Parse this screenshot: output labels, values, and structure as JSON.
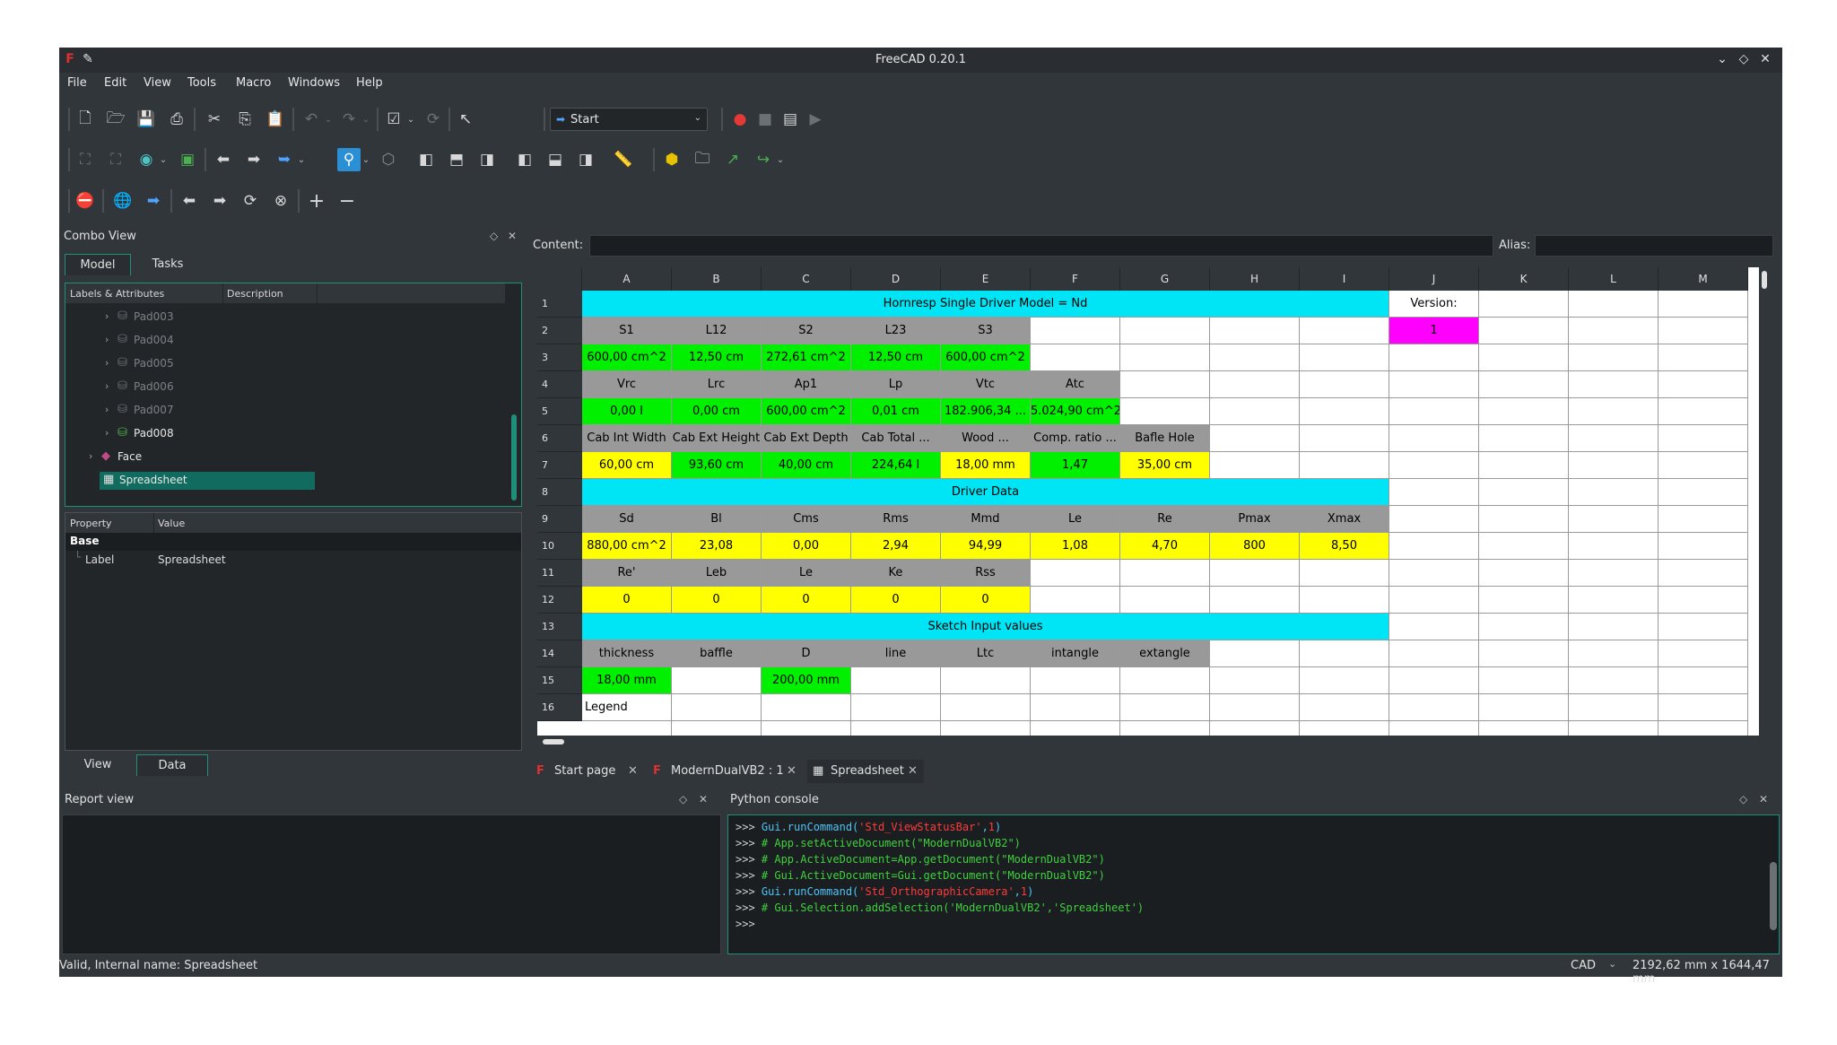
{
  "window": {
    "title": "FreeCAD 0.20.1"
  },
  "menu": [
    "File",
    "Edit",
    "View",
    "Tools",
    "Macro",
    "Windows",
    "Help"
  ],
  "workbench": {
    "selected": "Start"
  },
  "combo_view": {
    "title": "Combo View",
    "tabs": [
      "Model",
      "Tasks"
    ],
    "tree_headers": [
      "Labels & Attributes",
      "Description"
    ],
    "tree_items": [
      {
        "label": "Pad003",
        "dim": true
      },
      {
        "label": "Pad004",
        "dim": true
      },
      {
        "label": "Pad005",
        "dim": true
      },
      {
        "label": "Pad006",
        "dim": true
      },
      {
        "label": "Pad007",
        "dim": true
      },
      {
        "label": "Pad008",
        "dim": false
      },
      {
        "label": "Face",
        "dim": false
      },
      {
        "label": "Spreadsheet",
        "dim": false,
        "selected": true
      }
    ],
    "prop_headers": [
      "Property",
      "Value"
    ],
    "prop_group": "Base",
    "prop_name": "Label",
    "prop_value": "Spreadsheet",
    "bottom_tabs": [
      "View",
      "Data"
    ]
  },
  "spreadsheet": {
    "content_label": "Content:",
    "alias_label": "Alias:",
    "columns": [
      "A",
      "B",
      "C",
      "D",
      "E",
      "F",
      "G",
      "H",
      "I",
      "J",
      "K",
      "L",
      "M"
    ],
    "rows": [
      "1",
      "2",
      "3",
      "4",
      "5",
      "6",
      "7",
      "8",
      "9",
      "10",
      "11",
      "12",
      "13",
      "14",
      "15",
      "16"
    ],
    "colors": {
      "cyan": "#00e5f5",
      "grey": "#999999",
      "green": "#00f000",
      "yellow": "#ffff00",
      "magenta": "#ff00ff",
      "white": "#ffffff"
    },
    "cells": [
      {
        "r": 0,
        "c": 0,
        "span": 9,
        "t": "Hornresp Single Driver Model  = Nd",
        "bg": "cyan"
      },
      {
        "r": 0,
        "c": 9,
        "t": "Version:",
        "bg": "white"
      },
      {
        "r": 1,
        "c": 0,
        "t": "S1",
        "bg": "grey"
      },
      {
        "r": 1,
        "c": 1,
        "t": "L12",
        "bg": "grey"
      },
      {
        "r": 1,
        "c": 2,
        "t": "S2",
        "bg": "grey"
      },
      {
        "r": 1,
        "c": 3,
        "t": "L23",
        "bg": "grey"
      },
      {
        "r": 1,
        "c": 4,
        "t": "S3",
        "bg": "grey"
      },
      {
        "r": 1,
        "c": 9,
        "t": "1",
        "bg": "magenta"
      },
      {
        "r": 2,
        "c": 0,
        "t": "600,00 cm^2",
        "bg": "green"
      },
      {
        "r": 2,
        "c": 1,
        "t": "12,50 cm",
        "bg": "green"
      },
      {
        "r": 2,
        "c": 2,
        "t": "272,61 cm^2",
        "bg": "green"
      },
      {
        "r": 2,
        "c": 3,
        "t": "12,50 cm",
        "bg": "green"
      },
      {
        "r": 2,
        "c": 4,
        "t": "600,00 cm^2",
        "bg": "green"
      },
      {
        "r": 3,
        "c": 0,
        "t": "Vrc",
        "bg": "grey"
      },
      {
        "r": 3,
        "c": 1,
        "t": "Lrc",
        "bg": "grey"
      },
      {
        "r": 3,
        "c": 2,
        "t": "Ap1",
        "bg": "grey"
      },
      {
        "r": 3,
        "c": 3,
        "t": "Lp",
        "bg": "grey"
      },
      {
        "r": 3,
        "c": 4,
        "t": "Vtc",
        "bg": "grey"
      },
      {
        "r": 3,
        "c": 5,
        "t": "Atc",
        "bg": "grey"
      },
      {
        "r": 4,
        "c": 0,
        "t": "0,00 l",
        "bg": "green"
      },
      {
        "r": 4,
        "c": 1,
        "t": "0,00 cm",
        "bg": "green"
      },
      {
        "r": 4,
        "c": 2,
        "t": "600,00 cm^2",
        "bg": "green"
      },
      {
        "r": 4,
        "c": 3,
        "t": "0,01 cm",
        "bg": "green"
      },
      {
        "r": 4,
        "c": 4,
        "t": "182.906,34 ...",
        "bg": "green"
      },
      {
        "r": 4,
        "c": 5,
        "t": "5.024,90 cm^2",
        "bg": "green"
      },
      {
        "r": 5,
        "c": 0,
        "t": "Cab Int Width",
        "bg": "grey"
      },
      {
        "r": 5,
        "c": 1,
        "t": "Cab Ext Height",
        "bg": "grey"
      },
      {
        "r": 5,
        "c": 2,
        "t": "Cab Ext Depth",
        "bg": "grey"
      },
      {
        "r": 5,
        "c": 3,
        "t": "Cab Total ...",
        "bg": "grey"
      },
      {
        "r": 5,
        "c": 4,
        "t": "Wood ...",
        "bg": "grey"
      },
      {
        "r": 5,
        "c": 5,
        "t": "Comp. ratio ...",
        "bg": "grey"
      },
      {
        "r": 5,
        "c": 6,
        "t": "Bafle Hole",
        "bg": "grey"
      },
      {
        "r": 6,
        "c": 0,
        "t": "60,00 cm",
        "bg": "yellow"
      },
      {
        "r": 6,
        "c": 1,
        "t": "93,60 cm",
        "bg": "green"
      },
      {
        "r": 6,
        "c": 2,
        "t": "40,00 cm",
        "bg": "green"
      },
      {
        "r": 6,
        "c": 3,
        "t": "224,64 l",
        "bg": "green"
      },
      {
        "r": 6,
        "c": 4,
        "t": "18,00 mm",
        "bg": "yellow"
      },
      {
        "r": 6,
        "c": 5,
        "t": "1,47",
        "bg": "green"
      },
      {
        "r": 6,
        "c": 6,
        "t": "35,00 cm",
        "bg": "yellow"
      },
      {
        "r": 7,
        "c": 0,
        "span": 9,
        "t": "Driver Data",
        "bg": "cyan"
      },
      {
        "r": 8,
        "c": 0,
        "t": "Sd",
        "bg": "grey"
      },
      {
        "r": 8,
        "c": 1,
        "t": "Bl",
        "bg": "grey"
      },
      {
        "r": 8,
        "c": 2,
        "t": "Cms",
        "bg": "grey"
      },
      {
        "r": 8,
        "c": 3,
        "t": "Rms",
        "bg": "grey"
      },
      {
        "r": 8,
        "c": 4,
        "t": "Mmd",
        "bg": "grey"
      },
      {
        "r": 8,
        "c": 5,
        "t": "Le",
        "bg": "grey"
      },
      {
        "r": 8,
        "c": 6,
        "t": "Re",
        "bg": "grey"
      },
      {
        "r": 8,
        "c": 7,
        "t": "Pmax",
        "bg": "grey"
      },
      {
        "r": 8,
        "c": 8,
        "t": "Xmax",
        "bg": "grey"
      },
      {
        "r": 9,
        "c": 0,
        "t": "880,00 cm^2",
        "bg": "yellow"
      },
      {
        "r": 9,
        "c": 1,
        "t": "23,08",
        "bg": "yellow"
      },
      {
        "r": 9,
        "c": 2,
        "t": "0,00",
        "bg": "yellow"
      },
      {
        "r": 9,
        "c": 3,
        "t": "2,94",
        "bg": "yellow"
      },
      {
        "r": 9,
        "c": 4,
        "t": "94,99",
        "bg": "yellow"
      },
      {
        "r": 9,
        "c": 5,
        "t": "1,08",
        "bg": "yellow"
      },
      {
        "r": 9,
        "c": 6,
        "t": "4,70",
        "bg": "yellow"
      },
      {
        "r": 9,
        "c": 7,
        "t": "800",
        "bg": "yellow"
      },
      {
        "r": 9,
        "c": 8,
        "t": "8,50",
        "bg": "yellow"
      },
      {
        "r": 10,
        "c": 0,
        "t": "Re'",
        "bg": "grey"
      },
      {
        "r": 10,
        "c": 1,
        "t": "Leb",
        "bg": "grey"
      },
      {
        "r": 10,
        "c": 2,
        "t": "Le",
        "bg": "grey"
      },
      {
        "r": 10,
        "c": 3,
        "t": "Ke",
        "bg": "grey"
      },
      {
        "r": 10,
        "c": 4,
        "t": "Rss",
        "bg": "grey"
      },
      {
        "r": 11,
        "c": 0,
        "t": "0",
        "bg": "yellow"
      },
      {
        "r": 11,
        "c": 1,
        "t": "0",
        "bg": "yellow"
      },
      {
        "r": 11,
        "c": 2,
        "t": "0",
        "bg": "yellow"
      },
      {
        "r": 11,
        "c": 3,
        "t": "0",
        "bg": "yellow"
      },
      {
        "r": 11,
        "c": 4,
        "t": "0",
        "bg": "yellow"
      },
      {
        "r": 12,
        "c": 0,
        "span": 9,
        "t": "Sketch Input values",
        "bg": "cyan"
      },
      {
        "r": 13,
        "c": 0,
        "t": "thickness",
        "bg": "grey"
      },
      {
        "r": 13,
        "c": 1,
        "t": "baffle",
        "bg": "grey"
      },
      {
        "r": 13,
        "c": 2,
        "t": "D",
        "bg": "grey"
      },
      {
        "r": 13,
        "c": 3,
        "t": "line",
        "bg": "grey"
      },
      {
        "r": 13,
        "c": 4,
        "t": "Ltc",
        "bg": "grey"
      },
      {
        "r": 13,
        "c": 5,
        "t": "intangle",
        "bg": "grey"
      },
      {
        "r": 13,
        "c": 6,
        "t": "extangle",
        "bg": "grey"
      },
      {
        "r": 14,
        "c": 0,
        "t": "18,00 mm",
        "bg": "green"
      },
      {
        "r": 14,
        "c": 2,
        "t": "200,00 mm",
        "bg": "green"
      },
      {
        "r": 15,
        "c": 0,
        "t": "Legend",
        "bg": "white",
        "left": true
      }
    ]
  },
  "doc_tabs": [
    "Start page",
    "ModernDualVB2 : 1",
    "Spreadsheet"
  ],
  "report_view": {
    "title": "Report view"
  },
  "python_console": {
    "title": "Python console",
    "lines": [
      {
        "prompt": ">>> ",
        "parts": [
          {
            "t": "Gui.runCommand(",
            "c": "#4fc3f7"
          },
          {
            "t": "'Std_ViewStatusBar'",
            "c": "#ff3b3b"
          },
          {
            "t": ",",
            "c": "#4fc3f7"
          },
          {
            "t": "1",
            "c": "#ff3b3b"
          },
          {
            "t": ")",
            "c": "#4fc3f7"
          }
        ]
      },
      {
        "prompt": ">>> ",
        "parts": [
          {
            "t": "# App.setActiveDocument(\"ModernDualVB2\")",
            "c": "#3fd03f"
          }
        ]
      },
      {
        "prompt": ">>> ",
        "parts": [
          {
            "t": "# App.ActiveDocument=App.getDocument(\"ModernDualVB2\")",
            "c": "#3fd03f"
          }
        ]
      },
      {
        "prompt": ">>> ",
        "parts": [
          {
            "t": "# Gui.ActiveDocument=Gui.getDocument(\"ModernDualVB2\")",
            "c": "#3fd03f"
          }
        ]
      },
      {
        "prompt": ">>> ",
        "parts": [
          {
            "t": "Gui.runCommand(",
            "c": "#4fc3f7"
          },
          {
            "t": "'Std_OrthographicCamera'",
            "c": "#ff3b3b"
          },
          {
            "t": ",",
            "c": "#4fc3f7"
          },
          {
            "t": "1",
            "c": "#ff3b3b"
          },
          {
            "t": ")",
            "c": "#4fc3f7"
          }
        ]
      },
      {
        "prompt": ">>> ",
        "parts": [
          {
            "t": "# Gui.Selection.addSelection('ModernDualVB2','Spreadsheet')",
            "c": "#3fd03f"
          }
        ]
      },
      {
        "prompt": ">>> ",
        "parts": []
      }
    ]
  },
  "status": {
    "message": "Valid, Internal name: Spreadsheet",
    "nav_style": "CAD",
    "dimensions": "2192,62 mm x 1644,47 mm"
  }
}
